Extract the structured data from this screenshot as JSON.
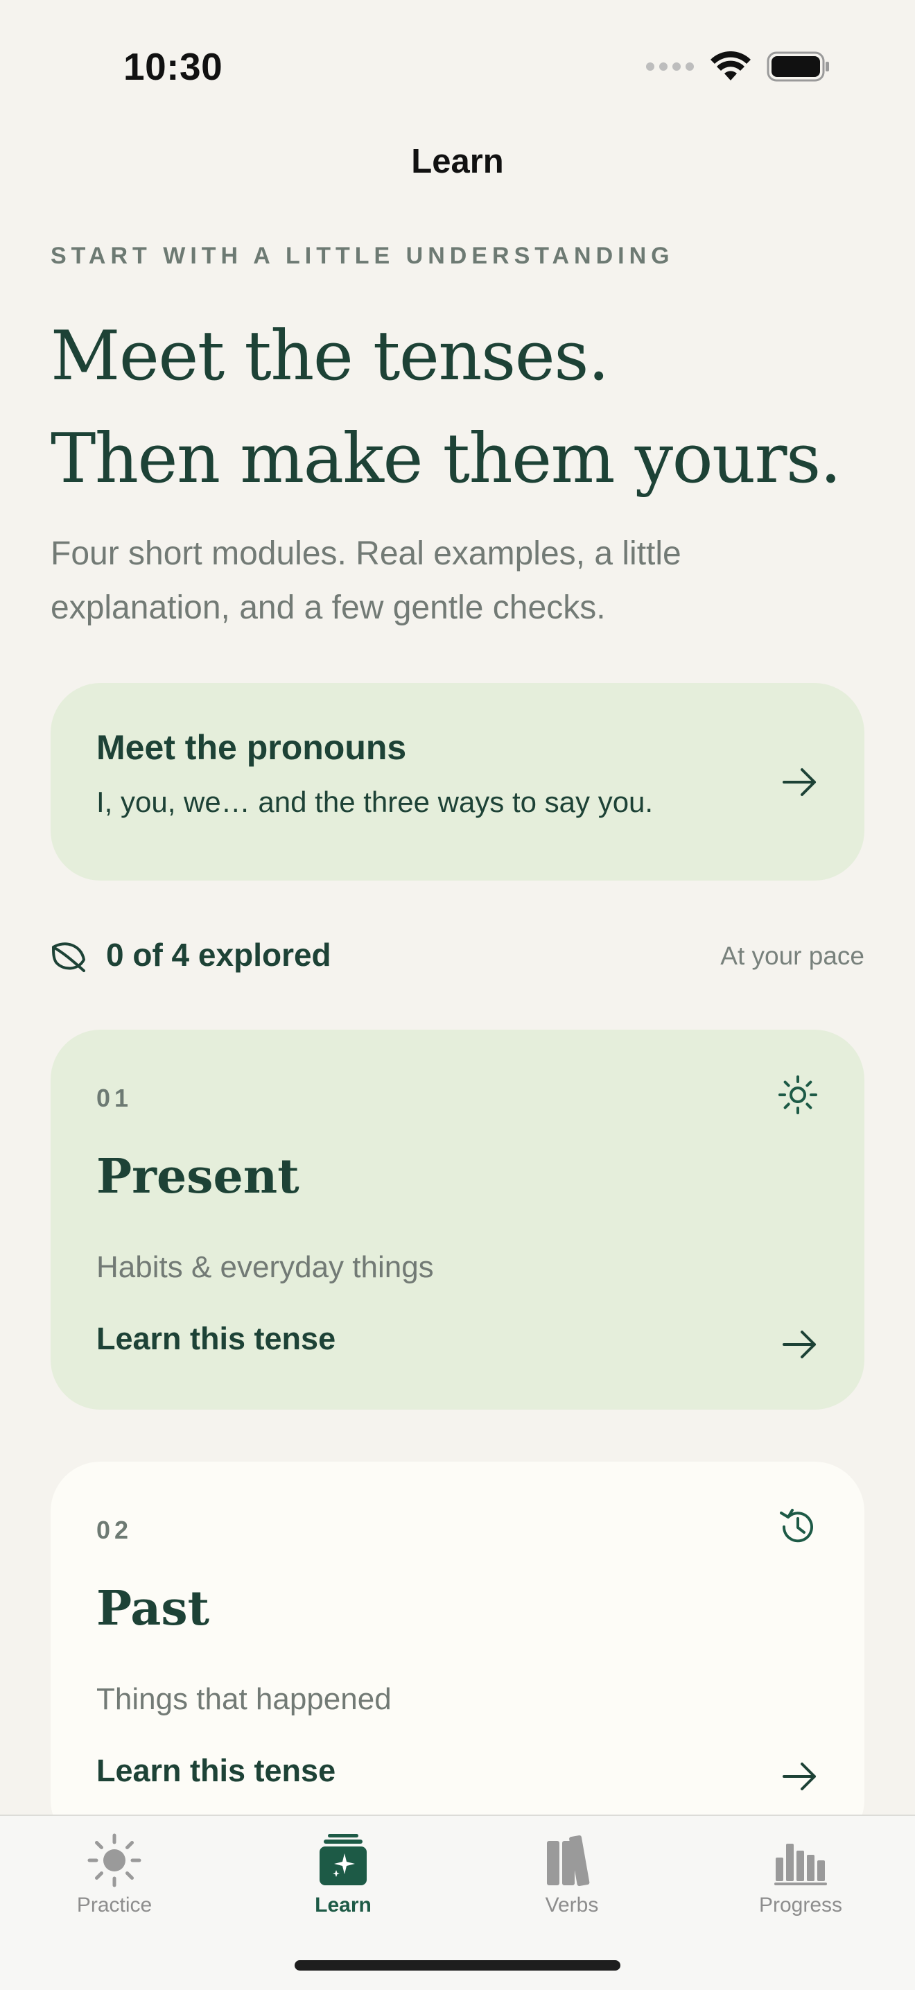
{
  "status_bar": {
    "time": "10:30"
  },
  "nav": {
    "title": "Learn"
  },
  "intro": {
    "kicker": "START WITH A LITTLE UNDERSTANDING",
    "headline_line1": "Meet the tenses.",
    "headline_line2": "Then make them yours.",
    "lede": "Four short modules. Real examples, a little explanation, and a few gentle checks."
  },
  "pronoun_card": {
    "title": "Meet the pronouns",
    "subtitle": "I, you, we… and the three ways to say you."
  },
  "progress": {
    "explored_text": "0 of 4 explored",
    "explored_count": 0,
    "total_count": 4,
    "pace_text": "At your pace"
  },
  "tenses": [
    {
      "number": "01",
      "name": "Present",
      "description": "Habits & everyday things",
      "cta": "Learn this tense",
      "icon": "sun-icon"
    },
    {
      "number": "02",
      "name": "Past",
      "description": "Things that happened",
      "cta": "Learn this tense",
      "icon": "history-icon"
    }
  ],
  "tab_bar": {
    "tabs": [
      {
        "label": "Practice",
        "icon": "sun-icon",
        "selected": false
      },
      {
        "label": "Learn",
        "icon": "learn-cards-icon",
        "selected": true
      },
      {
        "label": "Verbs",
        "icon": "books-icon",
        "selected": false
      },
      {
        "label": "Progress",
        "icon": "bar-chart-icon",
        "selected": false
      }
    ]
  },
  "colors": {
    "background": "#f5f3ee",
    "primary_text": "#1d4236",
    "muted_text": "#727a75",
    "card_green": "#e5eedb",
    "card_plain": "#fdfcf7",
    "accent": "#1d5a46"
  }
}
